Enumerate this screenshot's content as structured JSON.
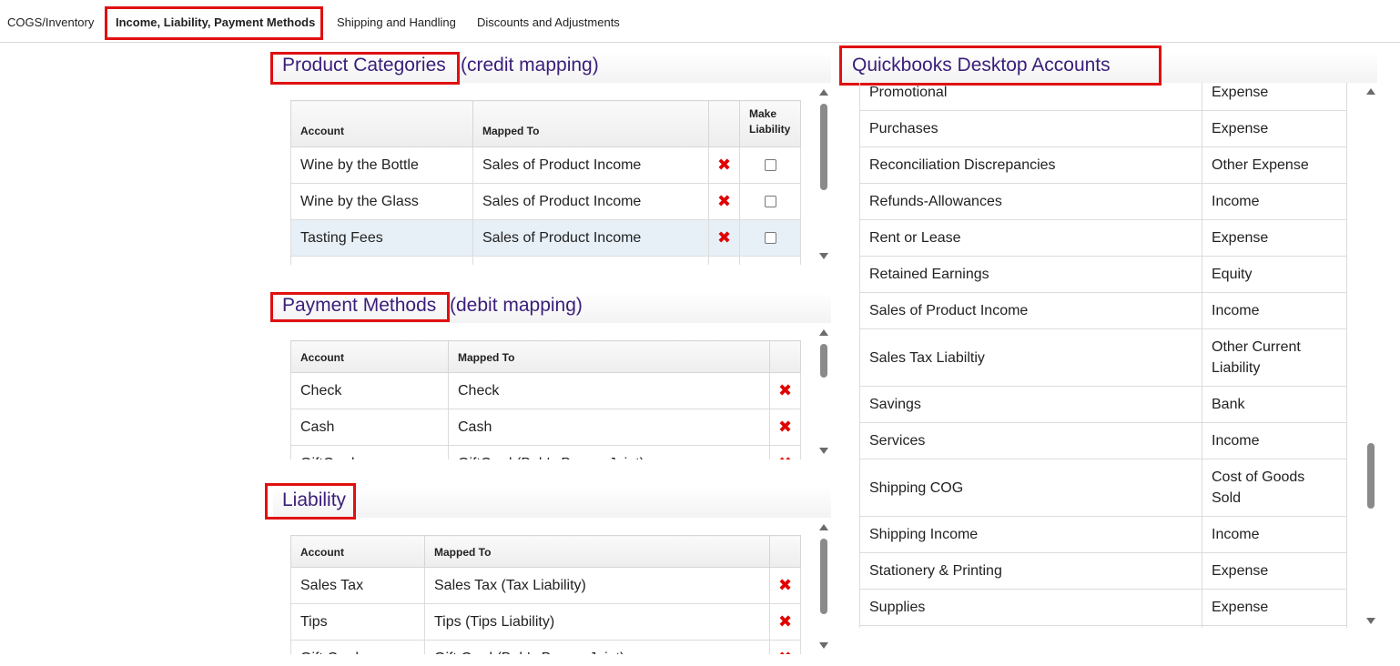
{
  "tabs": [
    {
      "label": "COGS/Inventory"
    },
    {
      "label": "Income, Liability, Payment Methods"
    },
    {
      "label": "Shipping and Handling"
    },
    {
      "label": "Discounts and Adjustments"
    }
  ],
  "product_categories": {
    "title": "Product Categories",
    "subtitle": "(credit mapping)",
    "columns": {
      "account": "Account",
      "mapped_to": "Mapped To",
      "make_liability": "Make Liability"
    },
    "rows": [
      {
        "account": "Wine by the Bottle",
        "mapped_to": "Sales of Product Income"
      },
      {
        "account": "Wine by the Glass",
        "mapped_to": "Sales of Product Income"
      },
      {
        "account": "Tasting Fees",
        "mapped_to": "Sales of Product Income"
      }
    ]
  },
  "payment_methods": {
    "title": "Payment Methods",
    "subtitle": "(debit mapping)",
    "columns": {
      "account": "Account",
      "mapped_to": "Mapped To"
    },
    "rows": [
      {
        "account": "Check",
        "mapped_to": "Check"
      },
      {
        "account": "Cash",
        "mapped_to": "Cash"
      },
      {
        "account": "GiftCard",
        "mapped_to": "GiftCard (Bob's Burger Joint)"
      }
    ]
  },
  "liability": {
    "title": "Liability",
    "columns": {
      "account": "Account",
      "mapped_to": "Mapped To"
    },
    "rows": [
      {
        "account": "Sales Tax",
        "mapped_to": "Sales Tax (Tax Liability)"
      },
      {
        "account": "Tips",
        "mapped_to": "Tips (Tips Liability)"
      },
      {
        "account": "Gift Card",
        "mapped_to": "Gift Card (Bob's Burger Joint)"
      }
    ]
  },
  "qb_accounts": {
    "title": "Quickbooks Desktop Accounts",
    "rows": [
      {
        "name": "Promotional",
        "type": "Expense"
      },
      {
        "name": "Purchases",
        "type": "Expense"
      },
      {
        "name": "Reconciliation Discrepancies",
        "type": "Other Expense"
      },
      {
        "name": "Refunds-Allowances",
        "type": "Income"
      },
      {
        "name": "Rent or Lease",
        "type": "Expense"
      },
      {
        "name": "Retained Earnings",
        "type": "Equity"
      },
      {
        "name": "Sales of Product Income",
        "type": "Income"
      },
      {
        "name": "Sales Tax Liabiltiy",
        "type": "Other Current Liability"
      },
      {
        "name": "Savings",
        "type": "Bank"
      },
      {
        "name": "Services",
        "type": "Income"
      },
      {
        "name": "Shipping COG",
        "type": "Cost of Goods Sold"
      },
      {
        "name": "Shipping Income",
        "type": "Income"
      },
      {
        "name": "Stationery & Printing",
        "type": "Expense"
      },
      {
        "name": "Supplies",
        "type": "Expense"
      },
      {
        "name": "",
        "type": ""
      }
    ]
  },
  "icons": {
    "remove": "✖"
  },
  "colors": {
    "highlight": "#e01010",
    "heading": "#3a1e7a",
    "remove": "#e00000",
    "selected_row": "#e7f0f7"
  }
}
